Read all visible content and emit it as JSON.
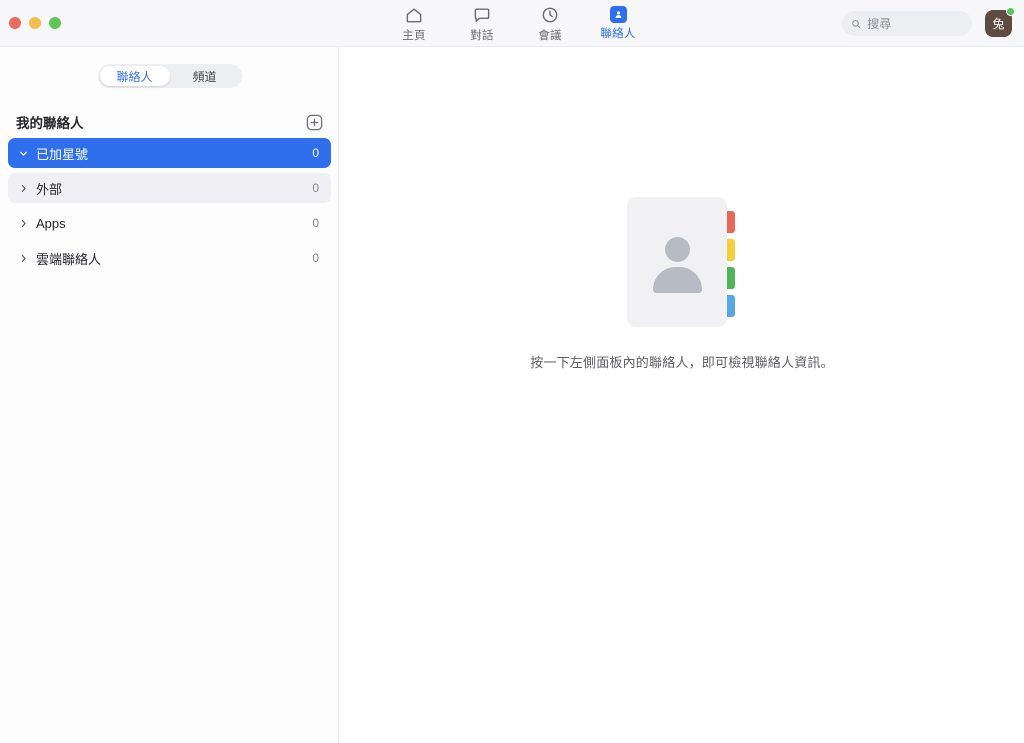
{
  "window": {
    "traffic_lights": [
      {
        "name": "close",
        "color": "#ed6a5f"
      },
      {
        "name": "minimize",
        "color": "#f4bd50"
      },
      {
        "name": "zoom",
        "color": "#61c555"
      }
    ]
  },
  "nav": {
    "items": [
      {
        "id": "home",
        "label": "主頁",
        "icon": "home-icon",
        "active": false
      },
      {
        "id": "chat",
        "label": "對話",
        "icon": "chat-bubble-icon",
        "active": false
      },
      {
        "id": "meetings",
        "label": "會議",
        "icon": "clock-icon",
        "active": false
      },
      {
        "id": "contacts",
        "label": "聯絡人",
        "icon": "contact-card-icon",
        "active": true
      }
    ],
    "active_color": "#2f6fed",
    "inactive_color": "#6b6b78"
  },
  "search": {
    "placeholder": "搜尋",
    "value": "",
    "icon": "search-icon"
  },
  "account": {
    "avatar_initial": "兔",
    "avatar_color": "#5f4b41",
    "status": "available",
    "status_color": "#54c45e"
  },
  "sidebar": {
    "tabs": [
      {
        "id": "contacts",
        "label": "聯絡人",
        "active": true
      },
      {
        "id": "channels",
        "label": "頻道",
        "active": false
      }
    ],
    "add_button": {
      "label": "",
      "icon": "plus-in-square-icon"
    },
    "group_title": "我的聯絡人",
    "rows": [
      {
        "id": "starred",
        "label": "已加星號",
        "count": "0",
        "chevron": "chevron-down-icon",
        "state": "selected"
      },
      {
        "id": "external",
        "label": "外部",
        "count": "0",
        "chevron": "chevron-right-icon",
        "state": "hover"
      },
      {
        "id": "apps",
        "label": "Apps",
        "count": "0",
        "chevron": "chevron-right-icon",
        "state": "normal"
      },
      {
        "id": "cloud-contacts",
        "label": "雲端聯絡人",
        "count": "0",
        "chevron": "chevron-right-icon",
        "state": "normal"
      }
    ]
  },
  "main": {
    "empty_state": {
      "illustration": "contact-book-illustration",
      "text": "按一下左側面板內的聯絡人，即可檢視聯絡人資訊。",
      "tab_colors": [
        "#e8695c",
        "#f5cd3d",
        "#52b55b",
        "#58a8e5"
      ]
    }
  }
}
